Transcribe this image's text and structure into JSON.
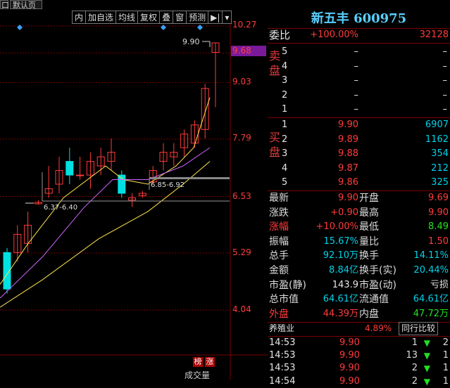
{
  "tabs": [
    "口",
    "默认页"
  ],
  "toolbar": [
    "内",
    "加自选",
    "均线",
    "复权",
    "叠",
    "窗",
    "预测",
    "▶|",
    "▾"
  ],
  "title": {
    "name": "新五丰",
    "code": "600975"
  },
  "weibi": {
    "label": "委比",
    "pct": "+100.00%",
    "val": "32128"
  },
  "sell_label": "卖盘",
  "sell": [
    {
      "lvl": "5",
      "price": "–",
      "vol": "–"
    },
    {
      "lvl": "4",
      "price": "–",
      "vol": "–"
    },
    {
      "lvl": "3",
      "price": "–",
      "vol": "–"
    },
    {
      "lvl": "2",
      "price": "–",
      "vol": "–"
    },
    {
      "lvl": "1",
      "price": "–",
      "vol": "–"
    }
  ],
  "buy_label": "买盘",
  "buy": [
    {
      "lvl": "1",
      "price": "9.90",
      "vol": "6907"
    },
    {
      "lvl": "2",
      "price": "9.89",
      "vol": "1162"
    },
    {
      "lvl": "3",
      "price": "9.88",
      "vol": "354"
    },
    {
      "lvl": "4",
      "price": "9.87",
      "vol": "212"
    },
    {
      "lvl": "5",
      "price": "9.86",
      "vol": "325"
    }
  ],
  "quote": [
    {
      "l1": "最新",
      "v1": "9.90",
      "c1": "red",
      "l2": "开盘",
      "v2": "9.69",
      "c2": "red"
    },
    {
      "l1": "涨跌",
      "v1": "+0.90",
      "c1": "red",
      "l2": "最高",
      "v2": "9.90",
      "c2": "red"
    },
    {
      "l1": "涨幅",
      "v1": "+10.00%",
      "c1": "red",
      "l2": "最低",
      "v2": "8.49",
      "c2": "green"
    },
    {
      "l1": "振幅",
      "v1": "15.67%",
      "c1": "cyan",
      "l2": "量比",
      "v2": "1.50",
      "c2": "red"
    },
    {
      "l1": "总手",
      "v1": "92.10万",
      "c1": "cyan",
      "l2": "换手",
      "v2": "14.11%",
      "c2": "cyan"
    },
    {
      "l1": "金额",
      "v1": "8.84亿",
      "c1": "cyan",
      "l2": "换手(实)",
      "v2": "20.44%",
      "c2": "cyan"
    },
    {
      "l1": "市盈(静)",
      "v1": "143.9",
      "c1": "white",
      "l2": "市盈(动)",
      "v2": "亏损",
      "c2": "white"
    },
    {
      "l1": "总市值",
      "v1": "64.61亿",
      "c1": "cyan",
      "l2": "流通值",
      "v2": "64.61亿",
      "c2": "cyan"
    },
    {
      "l1": "外盘",
      "v1": "44.39万",
      "c1": "red",
      "l2": "内盘",
      "v2": "47.72万",
      "c2": "green"
    }
  ],
  "industry": {
    "name": "养殖业",
    "pct": "4.89%",
    "btn": "同行比较"
  },
  "ticks": [
    {
      "time": "14:53",
      "price": "9.90",
      "vol": "1",
      "n": "2"
    },
    {
      "time": "14:53",
      "price": "9.90",
      "vol": "13",
      "n": "1"
    },
    {
      "time": "14:53",
      "price": "9.90",
      "vol": "2",
      "n": "1"
    },
    {
      "time": "14:54",
      "price": "9.90",
      "vol": "2",
      "n": "1"
    }
  ],
  "axis_labels": [
    "10.27",
    "9.68",
    "9.03",
    "7.79",
    "6.53",
    "5.29",
    "4.04"
  ],
  "current_price_label": "9.68",
  "annotations": {
    "high": "9.90",
    "range1": "6.37-6.40",
    "range2": "6.85-6.92"
  },
  "badges": [
    "榜",
    "涨"
  ],
  "volume_label": "成交量",
  "colors": {
    "up": "#ff3b3b",
    "down": "#00e0e0",
    "ma5": "#ffffff",
    "ma10": "#ffe34d",
    "ma20": "#cc66ff",
    "grid": "#7a0000"
  },
  "chart_data": {
    "type": "candlestick",
    "yticks": [
      10.27,
      9.68,
      9.03,
      7.79,
      6.53,
      5.29,
      4.04
    ],
    "candles": [
      {
        "o": 5.3,
        "h": 5.4,
        "l": 4.4,
        "c": 4.5,
        "dir": "down"
      },
      {
        "o": 5.3,
        "h": 5.9,
        "l": 5.1,
        "c": 5.7,
        "dir": "up"
      },
      {
        "o": 5.5,
        "h": 6.2,
        "l": 5.3,
        "c": 5.9,
        "dir": "up"
      },
      {
        "o": 6.37,
        "h": 6.45,
        "l": 6.35,
        "c": 6.4,
        "dir": "up"
      },
      {
        "o": 6.6,
        "h": 7.2,
        "l": 6.5,
        "c": 6.7,
        "dir": "up"
      },
      {
        "o": 6.8,
        "h": 7.4,
        "l": 6.6,
        "c": 7.1,
        "dir": "up"
      },
      {
        "o": 7.0,
        "h": 7.6,
        "l": 6.8,
        "c": 7.3,
        "dir": "down"
      },
      {
        "o": 7.0,
        "h": 7.4,
        "l": 6.9,
        "c": 7.0,
        "dir": "up"
      },
      {
        "o": 7.3,
        "h": 7.5,
        "l": 6.7,
        "c": 7.0,
        "dir": "up"
      },
      {
        "o": 7.2,
        "h": 7.6,
        "l": 7.0,
        "c": 7.4,
        "dir": "up"
      },
      {
        "o": 7.3,
        "h": 7.8,
        "l": 7.1,
        "c": 7.5,
        "dir": "up"
      },
      {
        "o": 7.0,
        "h": 7.1,
        "l": 6.5,
        "c": 6.6,
        "dir": "down"
      },
      {
        "o": 6.5,
        "h": 6.6,
        "l": 6.3,
        "c": 6.45,
        "dir": "up"
      },
      {
        "o": 6.55,
        "h": 6.65,
        "l": 6.5,
        "c": 6.6,
        "dir": "up"
      },
      {
        "o": 6.85,
        "h": 7.2,
        "l": 6.8,
        "c": 7.1,
        "dir": "up"
      },
      {
        "o": 7.3,
        "h": 7.7,
        "l": 7.1,
        "c": 7.5,
        "dir": "up"
      },
      {
        "o": 7.4,
        "h": 7.7,
        "l": 7.2,
        "c": 7.5,
        "dir": "up"
      },
      {
        "o": 7.6,
        "h": 8.0,
        "l": 7.4,
        "c": 7.9,
        "dir": "up"
      },
      {
        "o": 7.7,
        "h": 8.2,
        "l": 7.6,
        "c": 8.1,
        "dir": "up"
      },
      {
        "o": 8.0,
        "h": 9.0,
        "l": 7.8,
        "c": 8.9,
        "dir": "up"
      },
      {
        "o": 9.69,
        "h": 9.9,
        "l": 8.49,
        "c": 9.9,
        "dir": "up"
      }
    ]
  }
}
